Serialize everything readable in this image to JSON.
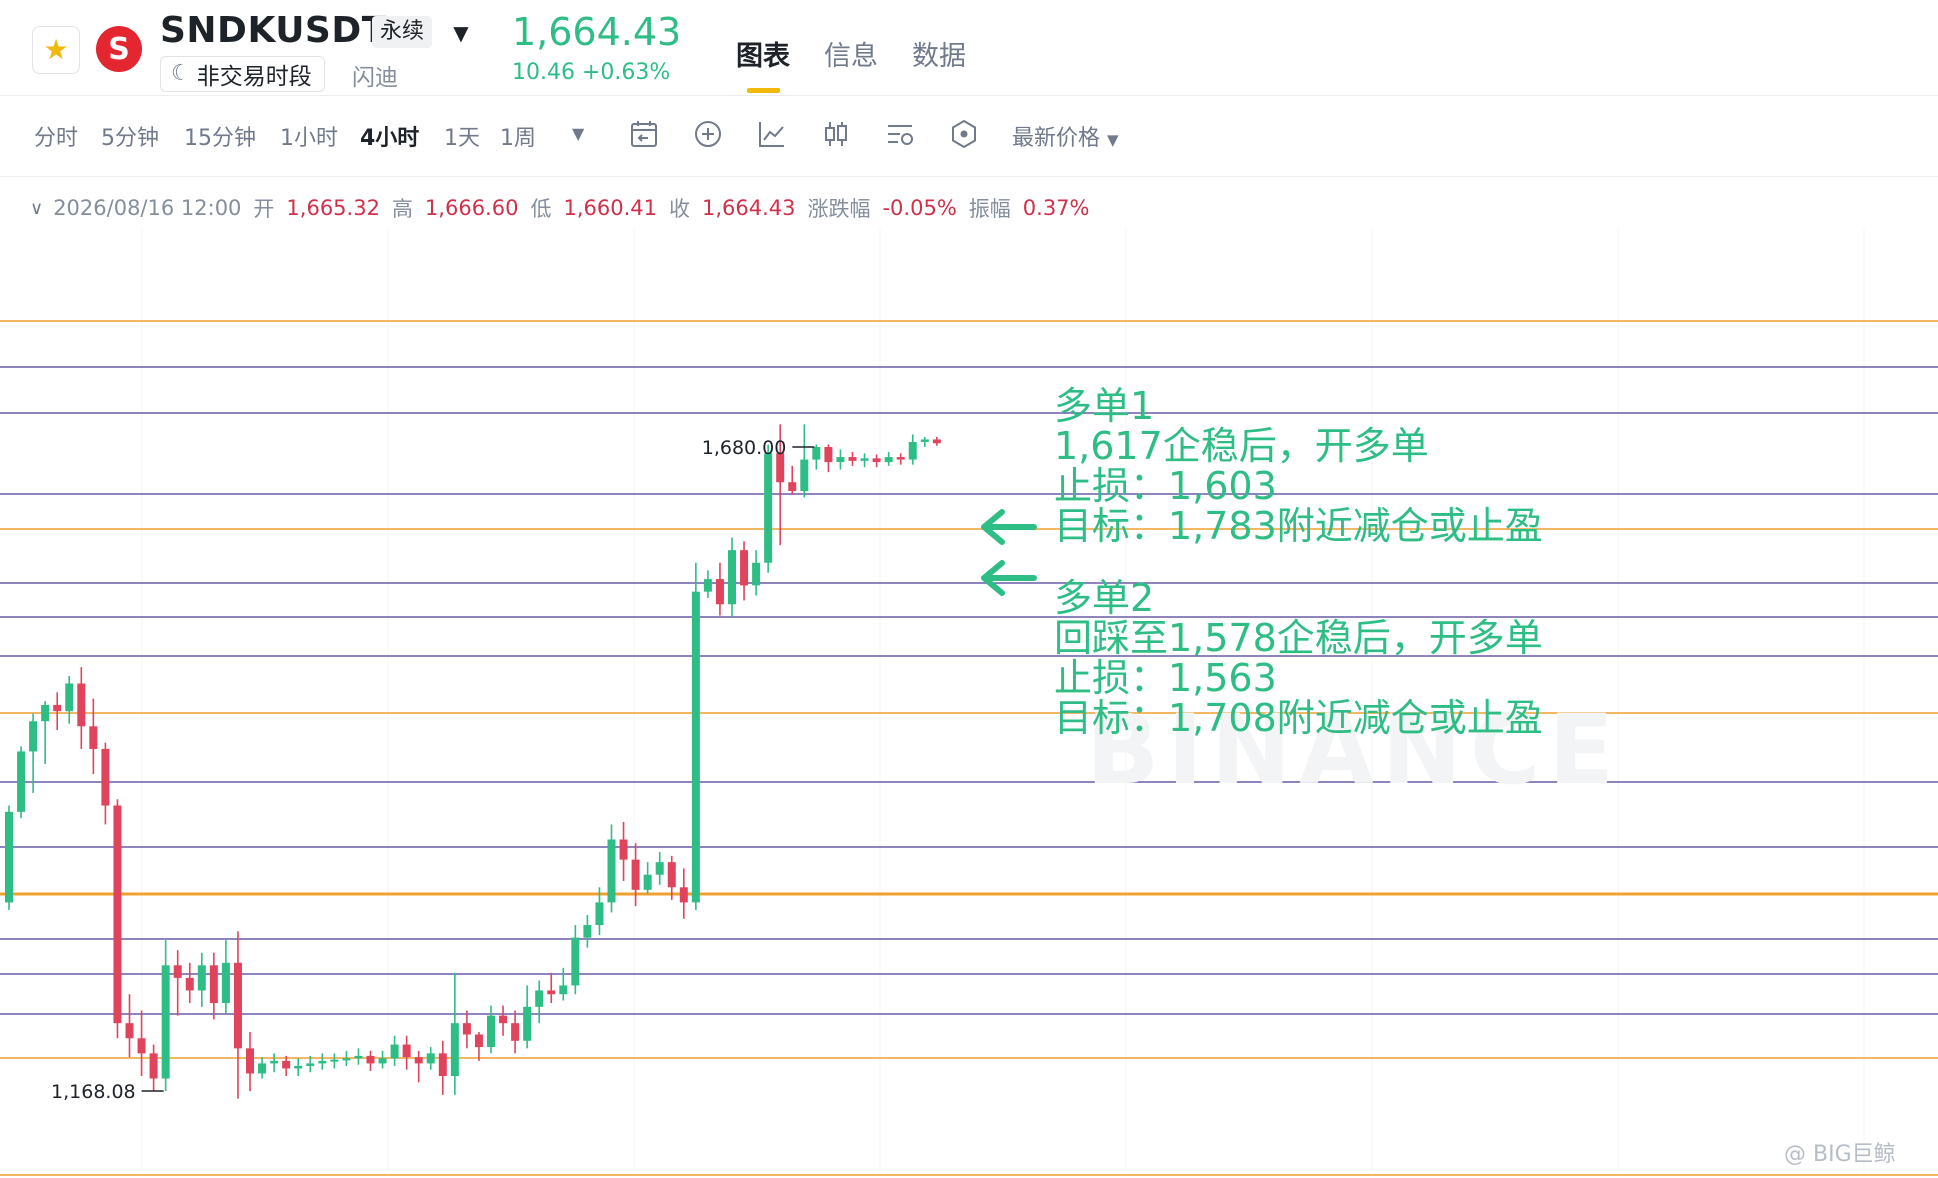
{
  "header": {
    "symbol": "SNDKUSDT",
    "contract_type": "永续",
    "session_status": "非交易时段",
    "company_name": "闪迪",
    "last_price": "1,664.43",
    "price_change": "10.46 +0.63%",
    "tabs": [
      "图表",
      "信息",
      "数据"
    ],
    "active_tab": "图表"
  },
  "toolbar": {
    "intervals": [
      "分时",
      "5分钟",
      "15分钟",
      "1小时",
      "4小时",
      "1天",
      "1周"
    ],
    "active_interval": "4小时",
    "price_type": "最新价格",
    "tool_icons": [
      "calendar-back-icon",
      "plus-circle-icon",
      "indicator-icon",
      "candle-type-icon",
      "settings-icon",
      "hexagon-icon"
    ]
  },
  "ohlc": {
    "time": "2026/08/16 12:00",
    "open_label": "开",
    "open": "1,665.32",
    "high_label": "高",
    "high": "1,666.60",
    "low_label": "低",
    "low": "1,660.41",
    "close_label": "收",
    "close": "1,664.43",
    "change_label": "涨跌幅",
    "change": "-0.05%",
    "amplitude_label": "振幅",
    "amplitude": "0.37%"
  },
  "chart_data": {
    "type": "candlestick",
    "interval": "4小时",
    "high_marker": "1,680.00",
    "low_marker": "1,168.08",
    "y_range": [
      1150,
      1800
    ],
    "colors": {
      "up": "#2ebd85",
      "down": "#e0445d",
      "line_orange": "#f0a030",
      "line_purple": "#6c5ba8"
    },
    "candles": [
      [
        1318,
        1390,
        1312,
        1395
      ],
      [
        1390,
        1438,
        1385,
        1442
      ],
      [
        1438,
        1462,
        1405,
        1468
      ],
      [
        1462,
        1475,
        1428,
        1478
      ],
      [
        1475,
        1470,
        1455,
        1485
      ],
      [
        1470,
        1492,
        1460,
        1498
      ],
      [
        1492,
        1458,
        1440,
        1505
      ],
      [
        1458,
        1440,
        1420,
        1480
      ],
      [
        1440,
        1395,
        1380,
        1445
      ],
      [
        1395,
        1222,
        1210,
        1400
      ],
      [
        1222,
        1210,
        1195,
        1245
      ],
      [
        1210,
        1198,
        1180,
        1232
      ],
      [
        1198,
        1178,
        1168.08,
        1205
      ],
      [
        1178,
        1268,
        1168.08,
        1288
      ],
      [
        1268,
        1258,
        1228,
        1280
      ],
      [
        1258,
        1248,
        1238,
        1270
      ],
      [
        1248,
        1268,
        1235,
        1278
      ],
      [
        1268,
        1238,
        1225,
        1278
      ],
      [
        1238,
        1270,
        1230,
        1288
      ],
      [
        1270,
        1202,
        1162,
        1295
      ],
      [
        1202,
        1182,
        1168,
        1215
      ],
      [
        1182,
        1190,
        1178,
        1195
      ],
      [
        1190,
        1192,
        1183,
        1198
      ],
      [
        1192,
        1186,
        1180,
        1196
      ],
      [
        1186,
        1188,
        1180,
        1194
      ],
      [
        1188,
        1190,
        1183,
        1196
      ],
      [
        1190,
        1192,
        1185,
        1198
      ],
      [
        1192,
        1193,
        1186,
        1198
      ],
      [
        1193,
        1194,
        1188,
        1200
      ],
      [
        1194,
        1196,
        1189,
        1202
      ],
      [
        1196,
        1190,
        1184,
        1200
      ],
      [
        1190,
        1194,
        1186,
        1200
      ],
      [
        1194,
        1205,
        1188,
        1212
      ],
      [
        1205,
        1195,
        1185,
        1212
      ],
      [
        1195,
        1190,
        1175,
        1200
      ],
      [
        1190,
        1198,
        1185,
        1203
      ],
      [
        1198,
        1180,
        1165,
        1208
      ],
      [
        1180,
        1222,
        1165,
        1262
      ],
      [
        1222,
        1213,
        1202,
        1232
      ],
      [
        1213,
        1203,
        1192,
        1215
      ],
      [
        1203,
        1228,
        1198,
        1236
      ],
      [
        1228,
        1222,
        1212,
        1236
      ],
      [
        1222,
        1208,
        1198,
        1232
      ],
      [
        1208,
        1235,
        1202,
        1252
      ],
      [
        1235,
        1248,
        1222,
        1256
      ],
      [
        1248,
        1245,
        1238,
        1262
      ],
      [
        1245,
        1252,
        1240,
        1266
      ],
      [
        1252,
        1290,
        1245,
        1300
      ],
      [
        1290,
        1300,
        1282,
        1308
      ],
      [
        1300,
        1318,
        1292,
        1330
      ],
      [
        1318,
        1368,
        1310,
        1380
      ],
      [
        1368,
        1352,
        1335,
        1382
      ],
      [
        1352,
        1328,
        1315,
        1365
      ],
      [
        1328,
        1340,
        1325,
        1350
      ],
      [
        1340,
        1350,
        1332,
        1358
      ],
      [
        1350,
        1330,
        1320,
        1355
      ],
      [
        1330,
        1318,
        1305,
        1345
      ],
      [
        1318,
        1565,
        1312,
        1588
      ],
      [
        1565,
        1575,
        1560,
        1582
      ],
      [
        1575,
        1555,
        1546,
        1588
      ],
      [
        1555,
        1598,
        1545,
        1608
      ],
      [
        1598,
        1570,
        1558,
        1605
      ],
      [
        1570,
        1588,
        1562,
        1598
      ],
      [
        1588,
        1675,
        1580,
        1682
      ],
      [
        1675,
        1652,
        1602,
        1698
      ],
      [
        1652,
        1645,
        1642,
        1665
      ],
      [
        1645,
        1670,
        1640,
        1698
      ],
      [
        1670,
        1680,
        1662,
        1682
      ],
      [
        1680,
        1668,
        1660,
        1682
      ],
      [
        1668,
        1672,
        1662,
        1678
      ],
      [
        1672,
        1669,
        1665,
        1676
      ],
      [
        1669,
        1671,
        1664,
        1675
      ],
      [
        1671,
        1668,
        1664,
        1674
      ],
      [
        1668,
        1672,
        1665,
        1676
      ],
      [
        1672,
        1670,
        1666,
        1675
      ],
      [
        1670,
        1684,
        1666,
        1690
      ],
      [
        1684,
        1686,
        1680,
        1688
      ],
      [
        1686,
        1683,
        1681,
        1688
      ]
    ]
  },
  "annotation": {
    "lines": [
      "多单1",
      "1,617企稳后，开多单",
      "止损：1,603",
      "目标：1,783附近减仓或止盈",
      "",
      "多单2",
      "回踩至1,578企稳后，开多单",
      "止损：1,563",
      "目标：1,708附近减仓或止盈"
    ]
  },
  "watermark": "BINANCE",
  "credit": "@ BIG巨鲸"
}
